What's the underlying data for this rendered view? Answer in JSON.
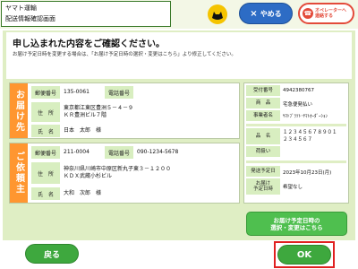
{
  "header": {
    "title_line1": "ヤマト運輸",
    "title_line2": "配送情報確認画面",
    "close_label": "やめる",
    "operator_line1": "オペレーターへ",
    "operator_line2": "連絡する"
  },
  "main": {
    "heading": "申し込まれた内容をご確認ください。",
    "subheading": "お届け予定日時を変更する場合は、「お届け予定日時の選択・変更はこちら」より修正してください。"
  },
  "delivery": {
    "section_label": "お届け先",
    "postal_label": "郵便番号",
    "postal_value": "135-0061",
    "phone_label": "電話番号",
    "phone_value": "",
    "address_label": "住　所",
    "address_line1": "東京都江東区豊洲５－４－９",
    "address_line2": "ＫＲ豊洲ビル７階",
    "name_label": "氏　名",
    "name_value": "日本　太郎　様"
  },
  "client": {
    "section_label": "ご依頼主",
    "postal_label": "郵便番号",
    "postal_value": "211-0004",
    "phone_label": "電話番号",
    "phone_value": "090-1234-5678",
    "address_label": "住　所",
    "address_line1": "神奈川県川崎市中原区新丸子東３－１２００",
    "address_line2": "ＫＤＸ武蔵小杉ビル",
    "name_label": "氏　名",
    "name_value": "大和　次郎　様"
  },
  "details": {
    "tracking_label": "受付番号",
    "tracking_value": "4942380767",
    "product_label": "商　品",
    "product_value": "宅急便発払い",
    "company_label": "事業者名",
    "company_value": "ﾔﾏﾄﾌﾞﾗﾂﾄ･ﾔﾏﾄｵｰﾀﾞｰｼｮﾝ",
    "item_label": "品　名",
    "item_line1": "１２３４５６７８９０１",
    "item_line2": "２３４５６７",
    "handling_label": "荷扱い",
    "handling_value": "",
    "ship_date_label": "発送予定日",
    "ship_date_value": "2023年10月23日(月)",
    "delivery_time_label1": "お届け",
    "delivery_time_label2": "予定日時",
    "delivery_time_value": "希望なし"
  },
  "buttons": {
    "change_line1": "お届け予定日時の",
    "change_line2": "選択・変更はこちら",
    "back": "戻る",
    "ok": "OK"
  },
  "colors": {
    "brand_green": "#3ea83e",
    "section_orange": "#ff9630",
    "label_green": "#d8eec0",
    "close_blue": "#2d6cc5",
    "alert_red": "#e02020"
  }
}
